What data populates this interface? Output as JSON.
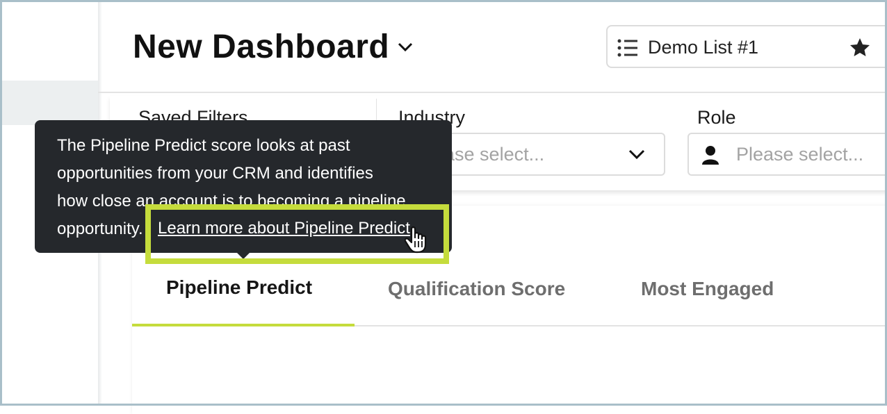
{
  "header": {
    "title": "New Dashboard",
    "list_name": "Demo List #1"
  },
  "filters": {
    "saved_filters_label": "Saved Filters",
    "industry_label": "Industry",
    "industry_placeholder": "Please select...",
    "role_label": "Role",
    "role_placeholder": "Please select..."
  },
  "tooltip": {
    "lines": [
      "The Pipeline Predict score looks at past",
      "opportunities from your CRM and identifies",
      "how close an account is to becoming a pipeline",
      "opportunity."
    ],
    "link": "Learn more about Pipeline Predict"
  },
  "tabs": [
    {
      "label": "Pipeline Predict",
      "active": true
    },
    {
      "label": "Qualification Score",
      "active": false
    },
    {
      "label": "Most Engaged",
      "active": false
    }
  ],
  "colors": {
    "accent": "#c5dc3c",
    "tooltip_bg": "#25282c",
    "border": "#dcdcdc"
  },
  "icons": [
    "chevron-down-icon",
    "list-icon",
    "star-icon",
    "user-icon",
    "hand-pointer-icon"
  ]
}
